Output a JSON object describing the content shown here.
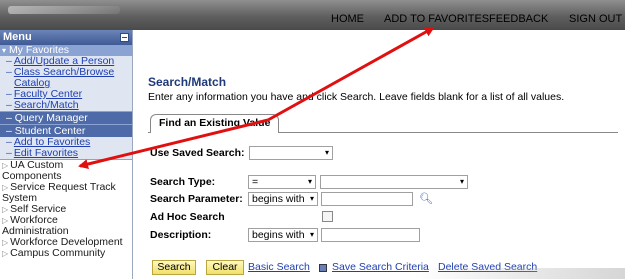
{
  "topnav": {
    "home": "HOME",
    "add_to_favorites": "ADD TO FAVORITES",
    "feedback": "FEEDBACK",
    "sign_out": "SIGN OUT"
  },
  "sidebar": {
    "menu_title": "Menu",
    "my_favorites": "My Favorites",
    "fav_links": [
      {
        "label": "Add/Update a Person"
      },
      {
        "label": "Class Search/Browse"
      },
      {
        "label": "Catalog"
      },
      {
        "label": "Faculty Center"
      },
      {
        "label": "Search/Match"
      }
    ],
    "query_manager": "Query Manager",
    "student_center": "Student Center",
    "add_to_favorites": "Add to Favorites",
    "edit_favorites": "Edit Favorites",
    "sections": [
      {
        "label": "UA Custom"
      },
      {
        "label": "Components"
      },
      {
        "label": "Service Request Track"
      },
      {
        "label": "System"
      },
      {
        "label": "Self Service"
      },
      {
        "label": "Workforce"
      },
      {
        "label": "Administration"
      },
      {
        "label": "Workforce Development"
      },
      {
        "label": "Campus Community"
      }
    ]
  },
  "main": {
    "title": "Search/Match",
    "instructions": "Enter any information you have and click Search. Leave fields blank for a list of all values.",
    "tab_label": "Find an Existing Value",
    "use_saved_search_label": "Use Saved Search:",
    "search_type_label": "Search Type:",
    "search_type_value": "=",
    "search_parameter_label": "Search Parameter:",
    "search_parameter_op": "begins with",
    "ad_hoc_label": "Ad Hoc Search",
    "description_label": "Description:",
    "description_op": "begins with",
    "search_button": "Search",
    "clear_button": "Clear",
    "basic_search_link": "Basic Search",
    "save_search_link": "Save Search Criteria",
    "delete_saved_link": "Delete Saved Search"
  },
  "colors": {
    "menu_header": "#3e5a94",
    "favorites_bg": "#8aa3d2",
    "link": "#1f3fb0",
    "annotation_arrow": "#e01010",
    "button": "#f0e06a"
  }
}
